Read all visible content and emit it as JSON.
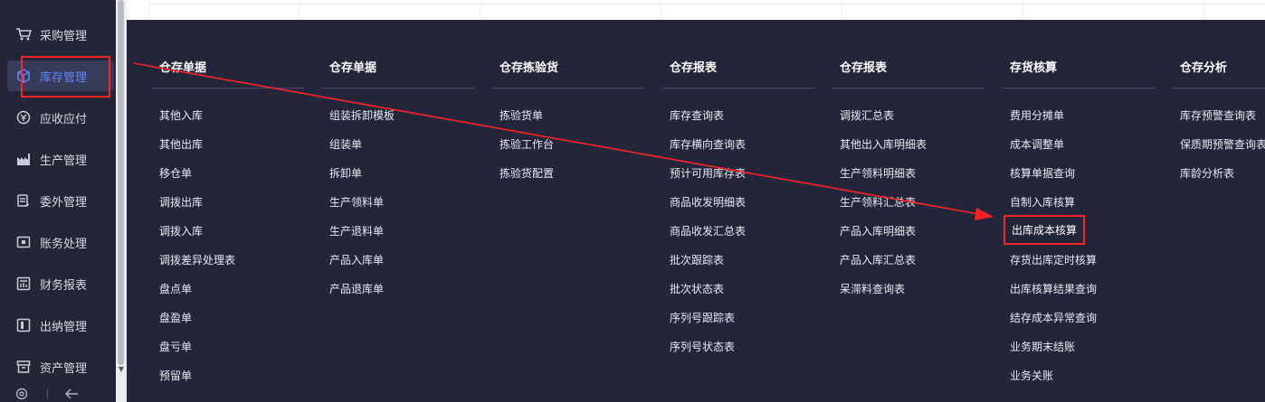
{
  "sidebar": {
    "items": [
      {
        "label": "采购管理",
        "icon": "cart-icon"
      },
      {
        "label": "库存管理",
        "icon": "cube-icon",
        "active": true
      },
      {
        "label": "应收应付",
        "icon": "coin-icon"
      },
      {
        "label": "生产管理",
        "icon": "factory-icon"
      },
      {
        "label": "委外管理",
        "icon": "outsource-icon"
      },
      {
        "label": "账务处理",
        "icon": "ledger-icon"
      },
      {
        "label": "财务报表",
        "icon": "report-icon"
      },
      {
        "label": "出纳管理",
        "icon": "cashier-icon"
      },
      {
        "label": "资产管理",
        "icon": "asset-icon"
      }
    ],
    "bottom_icons": [
      "settings-icon",
      "collapse-arrow-icon"
    ]
  },
  "menu": {
    "columns": [
      {
        "title": "仓存单据",
        "items": [
          "其他入库",
          "其他出库",
          "移仓单",
          "调拨出库",
          "调拨入库",
          "调拨差异处理表",
          "盘点单",
          "盘盈单",
          "盘亏单",
          "预留单"
        ]
      },
      {
        "title": "仓存单据",
        "items": [
          "组装拆卸模板",
          "组装单",
          "拆卸单",
          "生产领料单",
          "生产退料单",
          "产品入库单",
          "产品退库单"
        ]
      },
      {
        "title": "仓存拣验货",
        "items": [
          "拣验货单",
          "拣验工作台",
          "拣验货配置"
        ]
      },
      {
        "title": "仓存报表",
        "items": [
          "库存查询表",
          "库存横向查询表",
          "预计可用库存表",
          "商品收发明细表",
          "商品收发汇总表",
          "批次跟踪表",
          "批次状态表",
          "序列号跟踪表",
          "序列号状态表"
        ]
      },
      {
        "title": "仓存报表",
        "items": [
          "调拨汇总表",
          "其他出入库明细表",
          "生产领料明细表",
          "生产领料汇总表",
          "产品入库明细表",
          "产品入库汇总表",
          "呆滞料查询表"
        ]
      },
      {
        "title": "存货核算",
        "items": [
          "费用分摊单",
          "成本调整单",
          "核算单据查询",
          "自制入库核算",
          "出库成本核算",
          "存货出库定时核算",
          "出库核算结果查询",
          "结存成本异常查询",
          "业务期末结账",
          "业务关账"
        ]
      },
      {
        "title": "仓存分析",
        "items": [
          "库存预警查询表",
          "保质期预警查询表",
          "库龄分析表"
        ]
      }
    ],
    "highlighted_item": "出库成本核算"
  },
  "colors": {
    "sidebar_bg": "#242638",
    "menu_bg": "#23253b",
    "active_text": "#5e8bff",
    "annotation_red": "#ff2222"
  }
}
